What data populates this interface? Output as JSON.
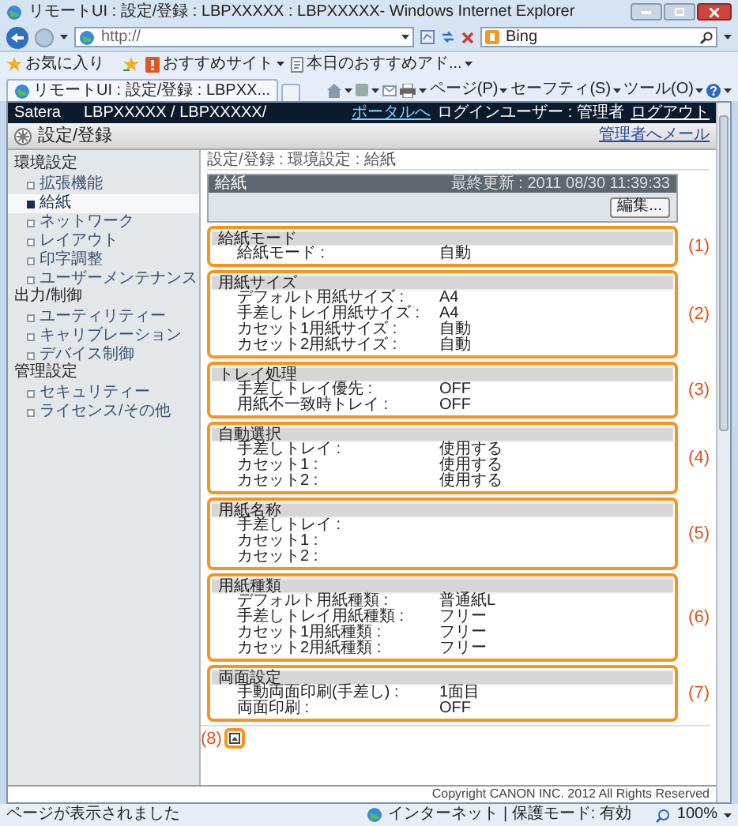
{
  "window": {
    "title": "リモートUI : 設定/登録 : LBPXXXXX : LBPXXXXX- Windows Internet Explorer"
  },
  "address_bar": {
    "value": "http://"
  },
  "search_box": {
    "value": "Bing"
  },
  "favorites_bar": {
    "favorites": "お気に入り",
    "items": [
      {
        "label": "おすすめサイト"
      },
      {
        "label": "本日のおすすめアド..."
      }
    ]
  },
  "tab": {
    "title": "リモートUI : 設定/登録 : LBPXX..."
  },
  "command_bar": [
    "ページ(P)",
    "セーフティ(S)",
    "ツール(O)"
  ],
  "page_header": {
    "product": "Satera",
    "device": "LBPXXXXX / LBPXXXXX/",
    "portal_link": "ポータルへ",
    "login_user": "ログインユーザー : 管理者",
    "logout_link": "ログアウト",
    "heading": "設定/登録",
    "mail_link": "管理者へメール"
  },
  "sidebar": {
    "groups": [
      {
        "title": "環境設定",
        "items": [
          {
            "label": "拡張機能",
            "selected": false
          },
          {
            "label": "給紙",
            "selected": true
          },
          {
            "label": "ネットワーク",
            "selected": false
          },
          {
            "label": "レイアウト",
            "selected": false
          },
          {
            "label": "印字調整",
            "selected": false
          },
          {
            "label": "ユーザーメンテナンス",
            "selected": false
          }
        ]
      },
      {
        "title": "出力/制御",
        "items": [
          {
            "label": "ユーティリティー",
            "selected": false
          },
          {
            "label": "キャリブレーション",
            "selected": false
          },
          {
            "label": "デバイス制御",
            "selected": false
          }
        ]
      },
      {
        "title": "管理設定",
        "items": [
          {
            "label": "セキュリティー",
            "selected": false
          },
          {
            "label": "ライセンス/その他",
            "selected": false
          }
        ]
      }
    ]
  },
  "breadcrumb": "設定/登録 : 環境設定 : 給紙",
  "panel": {
    "title": "給紙",
    "last_updated": "最終更新 : 2011 08/30 11:39:33",
    "edit_button": "編集..."
  },
  "sections": [
    {
      "title": "給紙モード",
      "callout": "(1)",
      "rows": [
        {
          "label": "給紙モード :",
          "value": "自動"
        }
      ]
    },
    {
      "title": "用紙サイズ",
      "callout": "(2)",
      "rows": [
        {
          "label": "デフォルト用紙サイズ :",
          "value": "A4"
        },
        {
          "label": "手差しトレイ用紙サイズ :",
          "value": "A4"
        },
        {
          "label": "カセット1用紙サイズ :",
          "value": "自動"
        },
        {
          "label": "カセット2用紙サイズ :",
          "value": "自動"
        }
      ]
    },
    {
      "title": "トレイ処理",
      "callout": "(3)",
      "rows": [
        {
          "label": "手差しトレイ優先 :",
          "value": "OFF"
        },
        {
          "label": "用紙不一致時トレイ :",
          "value": "OFF"
        }
      ]
    },
    {
      "title": "自動選択",
      "callout": "(4)",
      "rows": [
        {
          "label": "手差しトレイ :",
          "value": "使用する"
        },
        {
          "label": "カセット1 :",
          "value": "使用する"
        },
        {
          "label": "カセット2 :",
          "value": "使用する"
        }
      ]
    },
    {
      "title": "用紙名称",
      "callout": "(5)",
      "rows": [
        {
          "label": "手差しトレイ :"
        },
        {
          "label": "カセット1 :"
        },
        {
          "label": "カセット2 :"
        }
      ]
    },
    {
      "title": "用紙種類",
      "callout": "(6)",
      "rows": [
        {
          "label": "デフォルト用紙種類 :",
          "value": "普通紙L"
        },
        {
          "label": "手差しトレイ用紙種類 :",
          "value": "フリー"
        },
        {
          "label": "カセット1用紙種類 :",
          "value": "フリー"
        },
        {
          "label": "カセット2用紙種類 :",
          "value": "フリー"
        }
      ]
    },
    {
      "title": "両面設定",
      "callout": "(7)",
      "rows": [
        {
          "label": "手動両面印刷(手差し) :",
          "value": "1面目"
        },
        {
          "label": "両面印刷 :",
          "value": "OFF"
        }
      ]
    }
  ],
  "print_callout": "(8)",
  "copyright": "Copyright CANON INC. 2012 All Rights Reserved",
  "status_bar": {
    "message": "ページが表示されました",
    "zone": "インターネット | 保護モード: 有効",
    "zoom": "100%"
  }
}
